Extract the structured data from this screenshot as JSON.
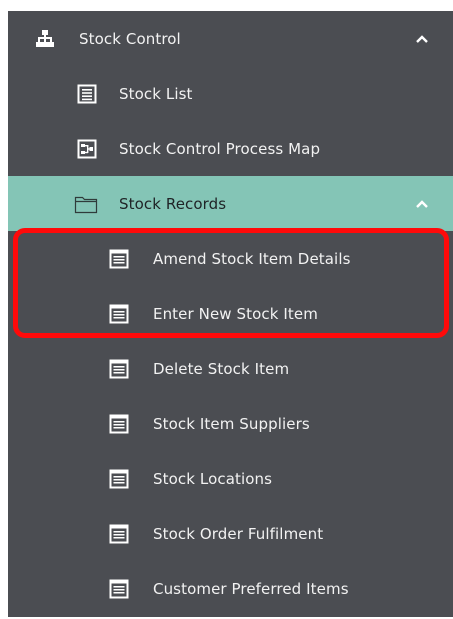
{
  "menu": {
    "section": {
      "label": "Stock Control",
      "icon": "hierarchy-icon",
      "expanded": true
    },
    "items": [
      {
        "label": "Stock List",
        "icon": "list-icon"
      },
      {
        "label": "Stock Control Process Map",
        "icon": "process-map-icon"
      },
      {
        "label": "Stock Records",
        "icon": "folder-icon",
        "active": true,
        "expanded": true
      }
    ],
    "sub_items": [
      {
        "label": "Amend Stock Item Details",
        "icon": "form-icon"
      },
      {
        "label": "Enter New Stock Item",
        "icon": "form-icon"
      },
      {
        "label": "Delete Stock Item",
        "icon": "form-icon"
      },
      {
        "label": "Stock Item Suppliers",
        "icon": "form-icon"
      },
      {
        "label": "Stock Locations",
        "icon": "form-icon"
      },
      {
        "label": "Stock Order Fulfilment",
        "icon": "form-icon"
      },
      {
        "label": "Customer Preferred Items",
        "icon": "form-icon"
      }
    ]
  },
  "colors": {
    "panel_bg": "#4b4d52",
    "active_bg": "#84c5b6",
    "highlight_border": "#ff0a0a",
    "text": "#f2f2f2"
  }
}
